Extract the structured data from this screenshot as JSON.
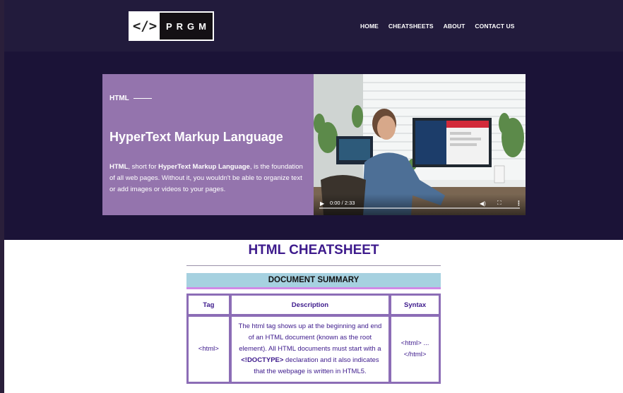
{
  "header": {
    "logo": {
      "code": "</>",
      "text": "PRGM"
    },
    "nav": [
      "HOME",
      "CHEATSHEETS",
      "ABOUT",
      "CONTACT US"
    ]
  },
  "hero": {
    "eyebrow": "HTML",
    "title": "HyperText Markup Language",
    "description": {
      "part1": "HTML",
      "part2": ", short for ",
      "part3": "HyperText Markup Language",
      "part4": ", is the foundation of all web pages. Without it, you wouldn't be able to organize text or add images or videos to your pages."
    },
    "video": {
      "time": "0:00 / 2:33",
      "play_icon": "play-icon",
      "volume_icon": "volume-icon",
      "fullscreen_icon": "fullscreen-icon",
      "more_icon": "more-icon"
    }
  },
  "cheatsheet": {
    "title": "HTML CHEATSHEET",
    "section": "DOCUMENT SUMMARY",
    "columns": [
      "Tag",
      "Description",
      "Syntax"
    ],
    "rows": [
      {
        "tag": "<html>",
        "desc_part1": "The html tag shows up at the beginning and end of an HTML document (known as the root element). All HTML documents must start with a ",
        "desc_bold": "<!DOCTYPE>",
        "desc_part2": " declaration and it also indicates that the webpage is written in HTML5.",
        "syntax": "<html> ... </html>"
      }
    ]
  },
  "colors": {
    "header_bg": "#221b3c",
    "hero_bg": "#1b1337",
    "card_bg": "#9474ad",
    "accent": "#3d1a8c",
    "summary_bg": "#a6d1e0",
    "table_border": "#8c6db6"
  }
}
